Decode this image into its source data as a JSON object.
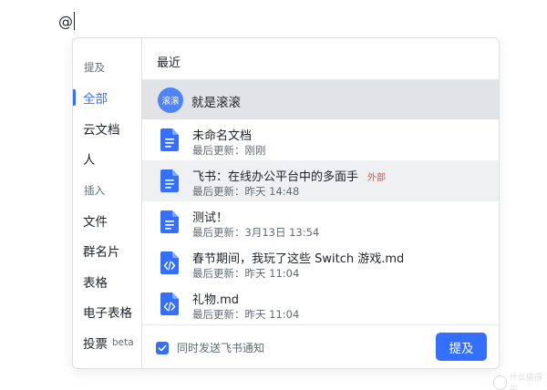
{
  "editor": {
    "typed": "@"
  },
  "sidebar": {
    "header_mention": "提及",
    "items_top": [
      {
        "label": "全部",
        "active": true
      },
      {
        "label": "云文档",
        "active": false
      },
      {
        "label": "人",
        "active": false
      }
    ],
    "header_insert": "插入",
    "items_bottom": [
      {
        "label": "文件"
      },
      {
        "label": "群名片"
      },
      {
        "label": "表格"
      },
      {
        "label": "电子表格"
      },
      {
        "label": "投票",
        "badge": "beta"
      }
    ]
  },
  "main": {
    "title": "最近",
    "user": {
      "avatar_text": "滚滚",
      "name": "就是滚滚"
    },
    "docs": [
      {
        "title": "未命名文档",
        "meta": "最后更新：刚刚",
        "icon": "doc-icon"
      },
      {
        "title": "飞书：在线办公平台中的多面手",
        "meta": "最后更新：昨天 14:48",
        "icon": "doc-icon",
        "badge": "外部"
      },
      {
        "title": "测试！",
        "meta": "最后更新：3月13日 13:54",
        "icon": "doc-icon"
      },
      {
        "title": "春节期间，我玩了这些 Switch 游戏.md",
        "meta": "最后更新：昨天 11:04",
        "icon": "code-file-icon"
      },
      {
        "title": "礼物.md",
        "meta": "最后更新：昨天 11:04",
        "icon": "code-file-icon"
      }
    ]
  },
  "footer": {
    "checkbox_label": "同时发送飞书通知",
    "checked": true,
    "submit_label": "提及"
  },
  "watermark": {
    "text": "什么值得买"
  },
  "colors": {
    "accent": "#3370ff",
    "selected_row": "#e1e3e6",
    "external_badge": "#f54a45"
  }
}
